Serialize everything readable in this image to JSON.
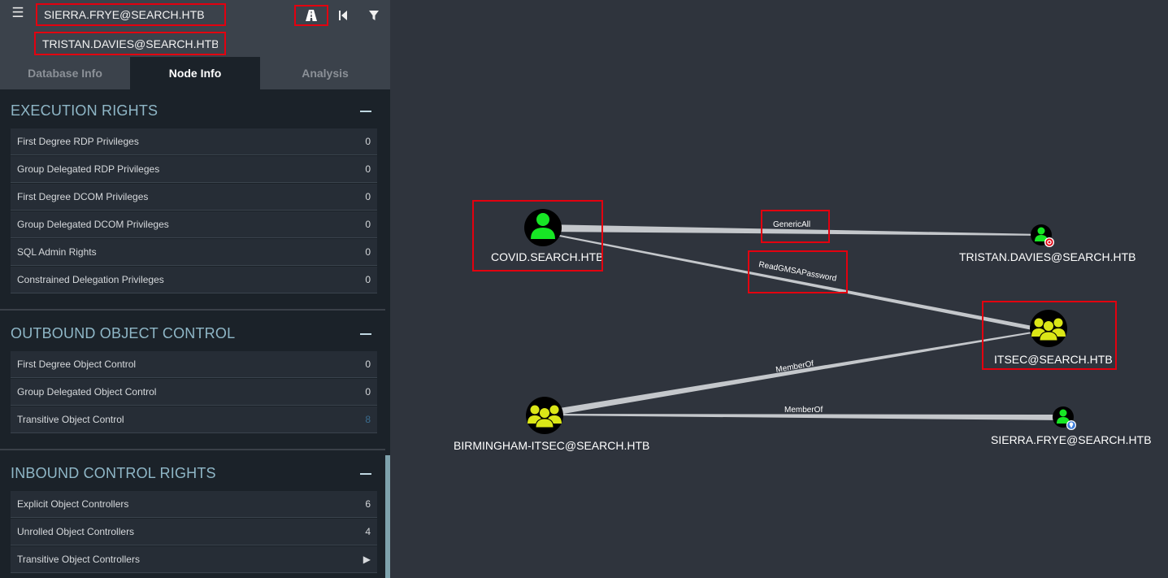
{
  "search": {
    "start_value": "SIERRA.FRYE@SEARCH.HTB",
    "target_value": "TRISTAN.DAVIES@SEARCH.HTB"
  },
  "icons": {
    "menu": "hamburger-menu-icon",
    "pathfinding": "road-icon",
    "back": "skip-back-icon",
    "filter": "filter-icon",
    "play": "play-icon"
  },
  "tabs": [
    "Database Info",
    "Node Info",
    "Analysis"
  ],
  "active_tab": "Node Info",
  "sections": [
    {
      "title": "EXECUTION RIGHTS",
      "rows": [
        {
          "label": "First Degree RDP Privileges",
          "value": "0"
        },
        {
          "label": "Group Delegated RDP Privileges",
          "value": "0"
        },
        {
          "label": "First Degree DCOM Privileges",
          "value": "0"
        },
        {
          "label": "Group Delegated DCOM Privileges",
          "value": "0"
        },
        {
          "label": "SQL Admin Rights",
          "value": "0"
        },
        {
          "label": "Constrained Delegation Privileges",
          "value": "0"
        }
      ]
    },
    {
      "title": "OUTBOUND OBJECT CONTROL",
      "rows": [
        {
          "label": "First Degree Object Control",
          "value": "0"
        },
        {
          "label": "Group Delegated Object Control",
          "value": "0"
        },
        {
          "label": "Transitive Object Control",
          "value": "8"
        }
      ]
    },
    {
      "title": "INBOUND CONTROL RIGHTS",
      "rows": [
        {
          "label": "Explicit Object Controllers",
          "value": "6"
        },
        {
          "label": "Unrolled Object Controllers",
          "value": "4"
        },
        {
          "label": "Transitive Object Controllers",
          "value": "▶"
        }
      ]
    }
  ],
  "graph": {
    "nodes": {
      "covid": "COVID.SEARCH.HTB",
      "tristan": "TRISTAN.DAVIES@SEARCH.HTB",
      "itsec": "ITSEC@SEARCH.HTB",
      "birmingham": "BIRMINGHAM-ITSEC@SEARCH.HTB",
      "sierra": "SIERRA.FRYE@SEARCH.HTB"
    },
    "edges": {
      "covid_tristan": "GenericAll",
      "covid_itsec": "ReadGMSAPassword",
      "birmingham_itsec": "MemberOf",
      "sierra_birmingham": "MemberOf"
    }
  },
  "colors": {
    "user_node": "#17e625",
    "group_node": "#dbe617",
    "highlight": "#e3000f",
    "target_badge": "#e3000f",
    "owned_badge": "#3d7ddb"
  }
}
